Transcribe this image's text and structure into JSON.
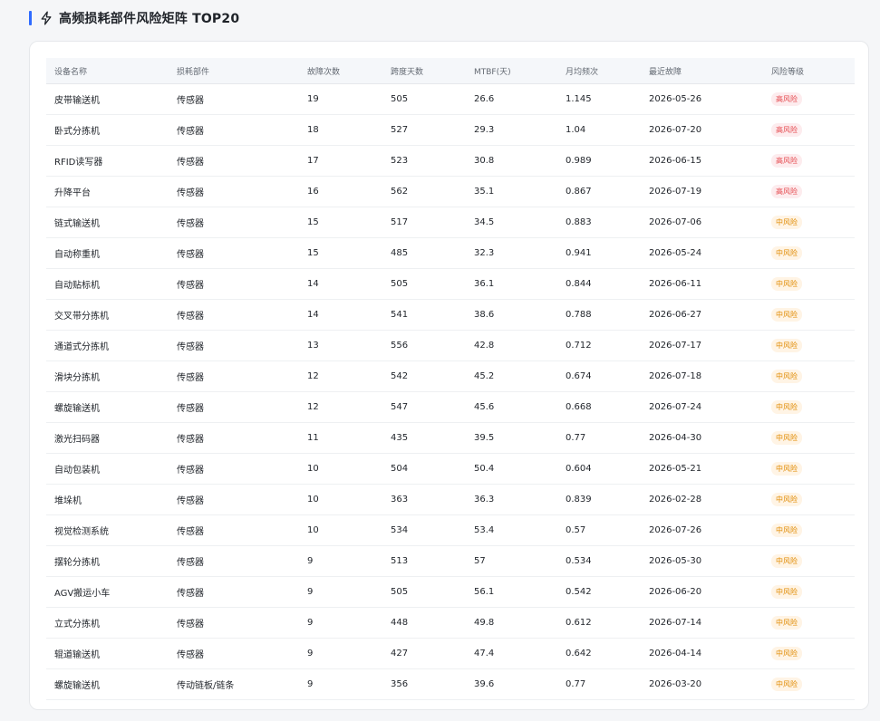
{
  "section": {
    "title": "高频损耗部件风险矩阵 TOP20",
    "icon": "lightning-bolt-icon",
    "accent_color": "#2f6bff"
  },
  "table": {
    "headers": [
      "设备名称",
      "损耗部件",
      "故障次数",
      "跨度天数",
      "MTBF(天)",
      "月均频次",
      "最近故障",
      "风险等级"
    ],
    "rows": [
      {
        "device": "皮带输送机",
        "part": "传感器",
        "faults": "19",
        "span": "505",
        "mtbf": "26.6",
        "monthly": "1.145",
        "last": "2026-05-26",
        "risk": "高风险",
        "level": "high"
      },
      {
        "device": "卧式分拣机",
        "part": "传感器",
        "faults": "18",
        "span": "527",
        "mtbf": "29.3",
        "monthly": "1.04",
        "last": "2026-07-20",
        "risk": "高风险",
        "level": "high"
      },
      {
        "device": "RFID读写器",
        "part": "传感器",
        "faults": "17",
        "span": "523",
        "mtbf": "30.8",
        "monthly": "0.989",
        "last": "2026-06-15",
        "risk": "高风险",
        "level": "high"
      },
      {
        "device": "升降平台",
        "part": "传感器",
        "faults": "16",
        "span": "562",
        "mtbf": "35.1",
        "monthly": "0.867",
        "last": "2026-07-19",
        "risk": "高风险",
        "level": "high"
      },
      {
        "device": "链式输送机",
        "part": "传感器",
        "faults": "15",
        "span": "517",
        "mtbf": "34.5",
        "monthly": "0.883",
        "last": "2026-07-06",
        "risk": "中风险",
        "level": "mid"
      },
      {
        "device": "自动称重机",
        "part": "传感器",
        "faults": "15",
        "span": "485",
        "mtbf": "32.3",
        "monthly": "0.941",
        "last": "2026-05-24",
        "risk": "中风险",
        "level": "mid"
      },
      {
        "device": "自动贴标机",
        "part": "传感器",
        "faults": "14",
        "span": "505",
        "mtbf": "36.1",
        "monthly": "0.844",
        "last": "2026-06-11",
        "risk": "中风险",
        "level": "mid"
      },
      {
        "device": "交叉带分拣机",
        "part": "传感器",
        "faults": "14",
        "span": "541",
        "mtbf": "38.6",
        "monthly": "0.788",
        "last": "2026-06-27",
        "risk": "中风险",
        "level": "mid"
      },
      {
        "device": "通道式分拣机",
        "part": "传感器",
        "faults": "13",
        "span": "556",
        "mtbf": "42.8",
        "monthly": "0.712",
        "last": "2026-07-17",
        "risk": "中风险",
        "level": "mid"
      },
      {
        "device": "滑块分拣机",
        "part": "传感器",
        "faults": "12",
        "span": "542",
        "mtbf": "45.2",
        "monthly": "0.674",
        "last": "2026-07-18",
        "risk": "中风险",
        "level": "mid"
      },
      {
        "device": "螺旋输送机",
        "part": "传感器",
        "faults": "12",
        "span": "547",
        "mtbf": "45.6",
        "monthly": "0.668",
        "last": "2026-07-24",
        "risk": "中风险",
        "level": "mid"
      },
      {
        "device": "激光扫码器",
        "part": "传感器",
        "faults": "11",
        "span": "435",
        "mtbf": "39.5",
        "monthly": "0.77",
        "last": "2026-04-30",
        "risk": "中风险",
        "level": "mid"
      },
      {
        "device": "自动包装机",
        "part": "传感器",
        "faults": "10",
        "span": "504",
        "mtbf": "50.4",
        "monthly": "0.604",
        "last": "2026-05-21",
        "risk": "中风险",
        "level": "mid"
      },
      {
        "device": "堆垛机",
        "part": "传感器",
        "faults": "10",
        "span": "363",
        "mtbf": "36.3",
        "monthly": "0.839",
        "last": "2026-02-28",
        "risk": "中风险",
        "level": "mid"
      },
      {
        "device": "视觉检测系统",
        "part": "传感器",
        "faults": "10",
        "span": "534",
        "mtbf": "53.4",
        "monthly": "0.57",
        "last": "2026-07-26",
        "risk": "中风险",
        "level": "mid"
      },
      {
        "device": "摆轮分拣机",
        "part": "传感器",
        "faults": "9",
        "span": "513",
        "mtbf": "57",
        "monthly": "0.534",
        "last": "2026-05-30",
        "risk": "中风险",
        "level": "mid"
      },
      {
        "device": "AGV搬运小车",
        "part": "传感器",
        "faults": "9",
        "span": "505",
        "mtbf": "56.1",
        "monthly": "0.542",
        "last": "2026-06-20",
        "risk": "中风险",
        "level": "mid"
      },
      {
        "device": "立式分拣机",
        "part": "传感器",
        "faults": "9",
        "span": "448",
        "mtbf": "49.8",
        "monthly": "0.612",
        "last": "2026-07-14",
        "risk": "中风险",
        "level": "mid"
      },
      {
        "device": "辊道输送机",
        "part": "传感器",
        "faults": "9",
        "span": "427",
        "mtbf": "47.4",
        "monthly": "0.642",
        "last": "2026-04-14",
        "risk": "中风险",
        "level": "mid"
      },
      {
        "device": "螺旋输送机",
        "part": "传动链板/链条",
        "faults": "9",
        "span": "356",
        "mtbf": "39.6",
        "monthly": "0.77",
        "last": "2026-03-20",
        "risk": "中风险",
        "level": "mid"
      }
    ]
  },
  "colors": {
    "high_risk_text": "#e5484d",
    "high_risk_bg": "#fdecee",
    "mid_risk_text": "#e08a00",
    "mid_risk_bg": "#fff4e5"
  }
}
